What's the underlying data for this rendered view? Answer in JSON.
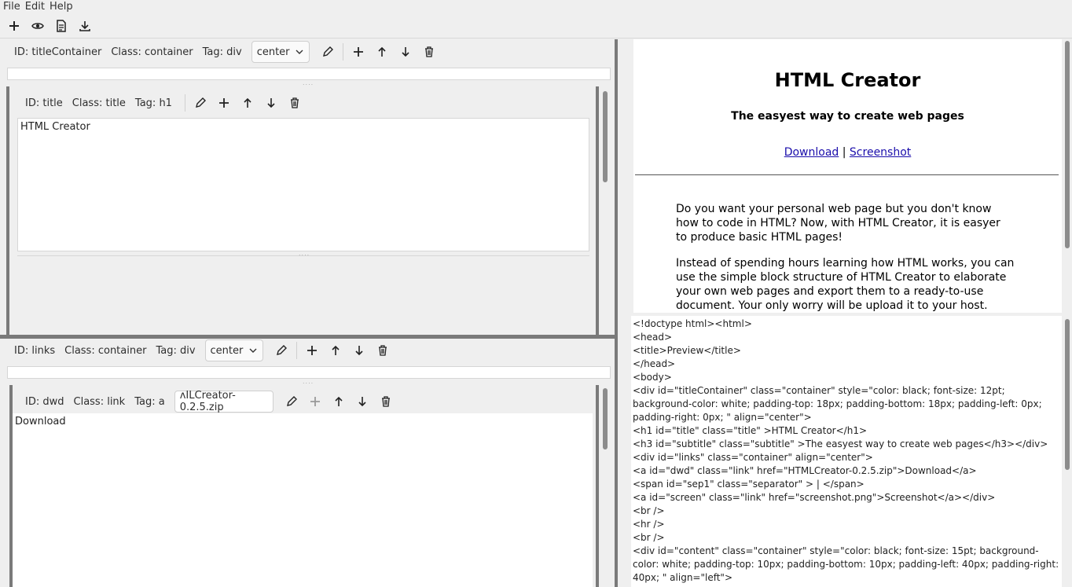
{
  "menu": {
    "file": "File",
    "edit": "Edit",
    "help": "Help"
  },
  "toolbar": {
    "icons": [
      "plus-icon",
      "eye-icon",
      "document-icon",
      "export-icon"
    ]
  },
  "block1": {
    "id": "ID: titleContainer",
    "cls": "Class: container",
    "tag": "Tag: div",
    "align": "center"
  },
  "block2": {
    "id": "ID: title",
    "cls": "Class: title",
    "tag": "Tag: h1",
    "text": "HTML Creator"
  },
  "block3": {
    "id": "ID: links",
    "cls": "Class: container",
    "tag": "Tag: div",
    "align": "center"
  },
  "block4": {
    "id": "ID: dwd",
    "cls": "Class: link",
    "tag": "Tag:  a",
    "href": "ʌILCreator-0.2.5.zip",
    "text": "Download"
  },
  "preview": {
    "title": "HTML Creator",
    "subtitle": "The easyest way to create web pages",
    "link1": "Download",
    "separator": "|",
    "link2": "Screenshot",
    "para1": "Do you want your personal web page but you don't know how to code in HTML? Now, with HTML Creator, it is easyer to produce basic HTML pages!",
    "para2": "Instead of spending hours learning how HTML works, you can use the simple block structure of HTML Creator to elaborate your own web pages and export them to a ready-to-use document. Your only worry will be upload it to your host."
  },
  "source_lines": [
    "<!doctype html><html>",
    "<head>",
    "<title>Preview</title>",
    "</head>",
    "<body>",
    "<div id=\"titleContainer\" class=\"container\" style=\"color: black; font-size: 12pt; background-color: white; padding-top: 18px; padding-bottom: 18px; padding-left: 0px; padding-right: 0px; \" align=\"center\">",
    "<h1 id=\"title\" class=\"title\" >HTML Creator</h1>",
    "<h3 id=\"subtitle\" class=\"subtitle\" >The easyest way to create web pages</h3></div>",
    "<div id=\"links\" class=\"container\" align=\"center\">",
    "<a id=\"dwd\" class=\"link\" href=\"HTMLCreator-0.2.5.zip\">Download</a>",
    "<span id=\"sep1\" class=\"separator\" > | </span>",
    "<a id=\"screen\" class=\"link\" href=\"screenshot.png\">Screenshot</a></div>",
    "<br />",
    "<hr />",
    "<br />",
    "<div id=\"content\" class=\"container\" style=\"color: black; font-size: 15pt; background-color: white; padding-top: 10px; padding-bottom: 10px; padding-left: 40px; padding-right: 40px; \" align=\"left\">"
  ]
}
